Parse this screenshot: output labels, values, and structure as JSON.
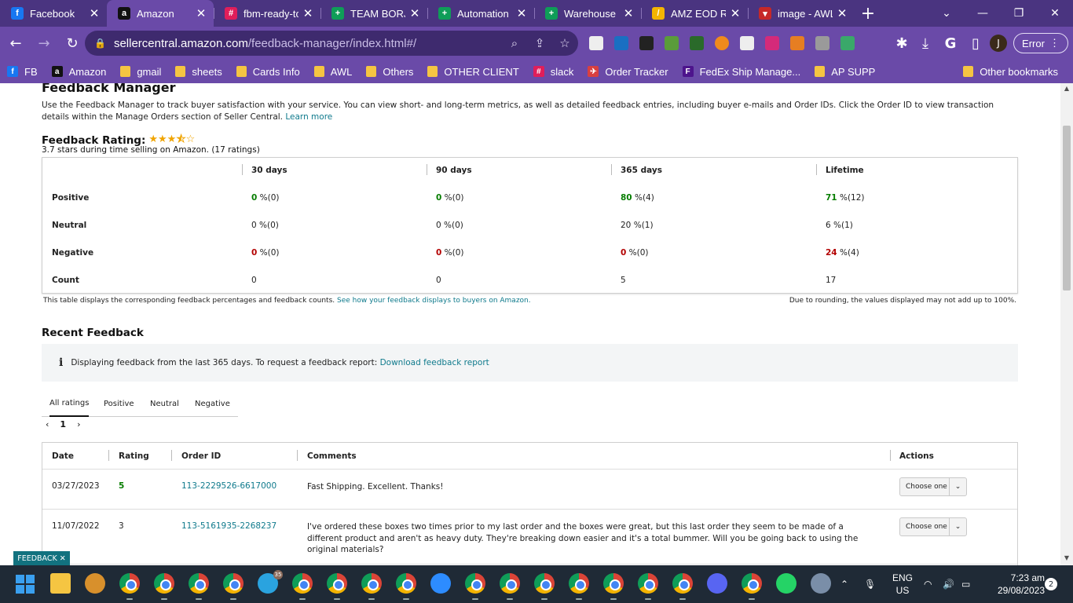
{
  "browser": {
    "tabs": [
      {
        "title": "Facebook",
        "icon": "facebook-icon",
        "color": "#1877f2",
        "glyph": "f"
      },
      {
        "title": "Amazon",
        "icon": "amazon-icon",
        "color": "#111111",
        "glyph": "a"
      },
      {
        "title": "fbm-ready-to",
        "icon": "slack-icon",
        "color": "#e01e5a",
        "glyph": "#"
      },
      {
        "title": "TEAM BORJ-L",
        "icon": "sheets-icon",
        "color": "#0f9d58",
        "glyph": "+"
      },
      {
        "title": "Automation S",
        "icon": "sheets-icon",
        "color": "#0f9d58",
        "glyph": "+"
      },
      {
        "title": "Warehouse S",
        "icon": "sheets-icon",
        "color": "#0f9d58",
        "glyph": "+"
      },
      {
        "title": "AMZ EOD Re",
        "icon": "pencil-icon",
        "color": "#f4b400",
        "glyph": "/"
      },
      {
        "title": "image - AWL",
        "icon": "image-icon",
        "color": "#c62828",
        "glyph": "▾"
      }
    ],
    "active_tab": 1,
    "url_host": "sellercentral.amazon.com",
    "url_path": "/feedback-manager/index.html#/",
    "error_label": "Error",
    "profile_initial": "J",
    "bookmarks": [
      {
        "label": "FB",
        "type": "icon",
        "color": "#1877f2",
        "glyph": "f"
      },
      {
        "label": "Amazon",
        "type": "icon",
        "color": "#111111",
        "glyph": "a"
      },
      {
        "label": "gmail",
        "type": "folder"
      },
      {
        "label": "sheets",
        "type": "folder"
      },
      {
        "label": "Cards Info",
        "type": "folder"
      },
      {
        "label": "AWL",
        "type": "folder"
      },
      {
        "label": "Others",
        "type": "folder"
      },
      {
        "label": "OTHER CLIENT",
        "type": "folder"
      },
      {
        "label": "slack",
        "type": "icon",
        "color": "#e01e5a",
        "glyph": "#"
      },
      {
        "label": "Order Tracker",
        "type": "icon",
        "color": "#d94040",
        "glyph": "✈"
      },
      {
        "label": "FedEx Ship Manage...",
        "type": "icon",
        "color": "#4d148c",
        "glyph": "F"
      },
      {
        "label": "AP SUPP",
        "type": "folder"
      }
    ],
    "other_bookmarks": "Other bookmarks"
  },
  "page": {
    "title": "Feedback Manager",
    "description": "Use the Feedback Manager to track buyer satisfaction with your service. You can view short- and long-term metrics, as well as detailed feedback entries, including buyer e-mails and Order IDs. Click the Order ID to view transaction details within the Manage Orders section of Seller Central.",
    "learn_more": "Learn more",
    "rating_label": "Feedback Rating:",
    "stars_value": 3.7,
    "rating_summary": "3.7 stars during time selling on Amazon. (17 ratings)",
    "table_note": "This table displays the corresponding feedback percentages and feedback counts.",
    "table_note_link": "See how your feedback displays to buyers on Amazon.",
    "rounding_note": "Due to rounding, the values displayed may not add up to 100%.",
    "recent_title": "Recent Feedback",
    "info_text": "Displaying feedback from the last 365 days. To request a feedback report:",
    "info_link": "Download feedback report",
    "filter_tabs": [
      "All ratings",
      "Positive",
      "Neutral",
      "Negative"
    ],
    "page_number": "1",
    "feedback_badge": "FEEDBACK ✕"
  },
  "summary": {
    "columns": [
      "30 days",
      "90 days",
      "365 days",
      "Lifetime"
    ],
    "rows": [
      {
        "label": "Positive",
        "cells": [
          {
            "pct": "0",
            "cnt": "%(0)"
          },
          {
            "pct": "0",
            "cnt": "%(0)"
          },
          {
            "pct": "80",
            "cnt": "%(4)"
          },
          {
            "pct": "71",
            "cnt": "%(12)"
          }
        ],
        "color": "green"
      },
      {
        "label": "Neutral",
        "cells": [
          {
            "pct": "0",
            "cnt": "%(0)"
          },
          {
            "pct": "0",
            "cnt": "%(0)"
          },
          {
            "pct": "20",
            "cnt": "%(1)"
          },
          {
            "pct": "6",
            "cnt": "%(1)"
          }
        ],
        "color": "plain"
      },
      {
        "label": "Negative",
        "cells": [
          {
            "pct": "0",
            "cnt": "%(0)"
          },
          {
            "pct": "0",
            "cnt": "%(0)"
          },
          {
            "pct": "0",
            "cnt": "%(0)"
          },
          {
            "pct": "24",
            "cnt": "%(4)"
          }
        ],
        "color": "red"
      },
      {
        "label": "Count",
        "cells": [
          {
            "pct": "0",
            "cnt": ""
          },
          {
            "pct": "0",
            "cnt": ""
          },
          {
            "pct": "5",
            "cnt": ""
          },
          {
            "pct": "17",
            "cnt": ""
          }
        ],
        "color": "plain"
      }
    ]
  },
  "feedback": {
    "headers": [
      "Date",
      "Rating",
      "Order ID",
      "Comments",
      "Actions"
    ],
    "action_label": "Choose one",
    "rows": [
      {
        "date": "03/27/2023",
        "rating": "5",
        "order_id": "113-2229526-6617000",
        "comment": "Fast Shipping. Excellent. Thanks!"
      },
      {
        "date": "11/07/2022",
        "rating": "3",
        "order_id": "113-5161935-2268237",
        "comment": "I've ordered these boxes two times prior to my last order and the boxes were great, but this last order they seem to be made of a different product and aren't as heavy duty. They're breaking down easier and it's a total bummer. Will you be going back to using the original materials?"
      }
    ]
  },
  "taskbar": {
    "lang": "ENG",
    "region": "US",
    "time": "7:23 am",
    "date": "29/08/2023",
    "notifications": "2",
    "telegram_badge": "35"
  },
  "colors": {
    "chrome_dark": "#4a3480",
    "chrome_light": "#6a4aa8",
    "link": "#0f7a8c",
    "positive": "#067d00",
    "negative": "#b30000",
    "star": "#f0a400"
  }
}
